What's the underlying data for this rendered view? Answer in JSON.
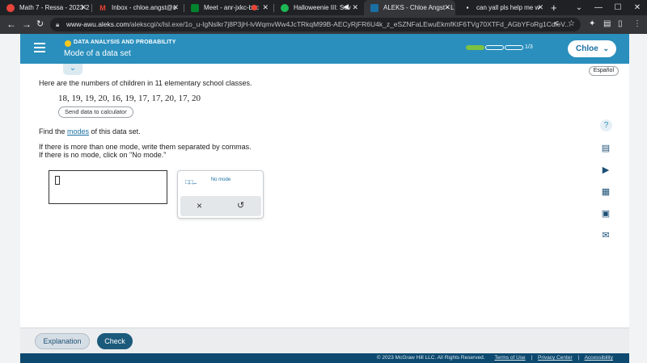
{
  "browser": {
    "tabs": [
      {
        "title": "Math 7 - Ressa - 2023-2",
        "favicon_color": "#e8453c",
        "favicon": "○"
      },
      {
        "title": "Inbox - chloe.angst@s",
        "favicon_color": "#202124",
        "favicon": "M"
      },
      {
        "title": "Meet - anr-jxkc-bkc",
        "favicon_color": "#00832d",
        "favicon": "▶"
      },
      {
        "title": "Halloweenie III: Sev",
        "favicon_color": "#1db954",
        "favicon": "♫"
      },
      {
        "title": "ALEKS - Chloe Angst - L",
        "favicon_color": "#1a6fa3",
        "favicon": "A"
      },
      {
        "title": "can yall pls help me w",
        "favicon_color": "#202124",
        "favicon": "▪"
      }
    ],
    "new_tab": "+",
    "url_host": "www-awu.aleks.com",
    "url_path": "/alekscgi/x/Isl.exe/1o_u-IgNslkr7j8P3jH-lvWqmvWw4JcTRkqM99B-AECyRjFR6U4k_z_eSZNFaLEwuEkmfKtF6TVg70XTFd_AGbYFoRg1CdieV..."
  },
  "header": {
    "category": "DATA ANALYSIS AND PROBABILITY",
    "title": "Mode of a data set",
    "progress": {
      "completed": 1,
      "total": 3,
      "label": "1/3"
    },
    "user": "Chloe",
    "accent_color": "#2a8fbd"
  },
  "question": {
    "language_link": "Español",
    "intro": "Here are the numbers of children in 11 elementary school classes.",
    "data": "18, 19, 19, 20, 16, 19, 17, 17, 20, 17, 20",
    "calc_button": "Send data to calculator",
    "prompt_before": "Find the ",
    "prompt_link": "modes",
    "prompt_after": " of this data set.",
    "instruction_1": "If there is more than one mode, write them separated by commas.",
    "instruction_2": "If there is no mode, click on \"No mode.\""
  },
  "keypad": {
    "list_key": "□,□,...",
    "no_mode": "No mode",
    "clear": "×",
    "undo": "↺"
  },
  "buttons": {
    "explanation": "Explanation",
    "check": "Check"
  },
  "footer": {
    "copyright": "© 2023 McGraw Hill LLC. All Rights Reserved.",
    "terms": "Terms of Use",
    "privacy": "Privacy Center",
    "accessibility": "Accessibility"
  }
}
